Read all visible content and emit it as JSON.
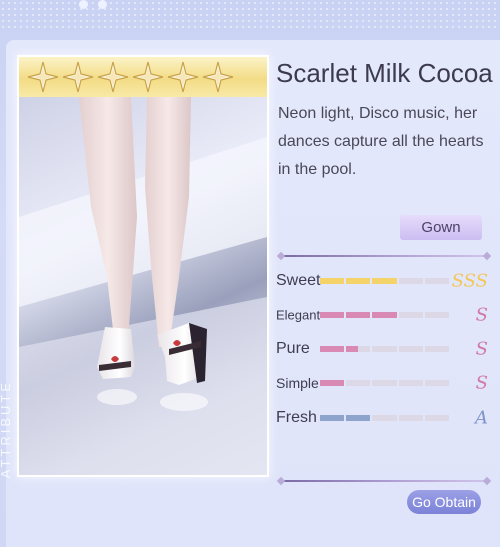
{
  "item": {
    "name": "Scarlet Milk Cocoa",
    "description": "Neon light, Disco music, her dances capture all the hearts in the pool.",
    "rarity_stars": 6,
    "tag": "Gown",
    "side_label": "ATTRIBUTE"
  },
  "attributes": [
    {
      "label": "Sweet",
      "filled": 3,
      "total": 5,
      "grade": "SSS",
      "bar_color": "#f4d46a",
      "grade_color": "#f2c75a"
    },
    {
      "label": "Elegant",
      "filled": 3,
      "total": 5,
      "grade": "S",
      "bar_color": "#d98ab4",
      "grade_color": "#d07aa6"
    },
    {
      "label": "Pure",
      "filled": 1.5,
      "total": 5,
      "grade": "S",
      "bar_color": "#d98ab4",
      "grade_color": "#d07aa6"
    },
    {
      "label": "Simple",
      "filled": 1,
      "total": 5,
      "grade": "S",
      "bar_color": "#d98ab4",
      "grade_color": "#d07aa6"
    },
    {
      "label": "Fresh",
      "filled": 2,
      "total": 5,
      "grade": "A",
      "bar_color": "#8fa4cc",
      "grade_color": "#7f95c9"
    }
  ],
  "actions": {
    "obtain": "Go Obtain"
  },
  "colors": {
    "background": "#d4dbf6",
    "accent": "#7c82d6",
    "gold": "#f3dc86"
  }
}
